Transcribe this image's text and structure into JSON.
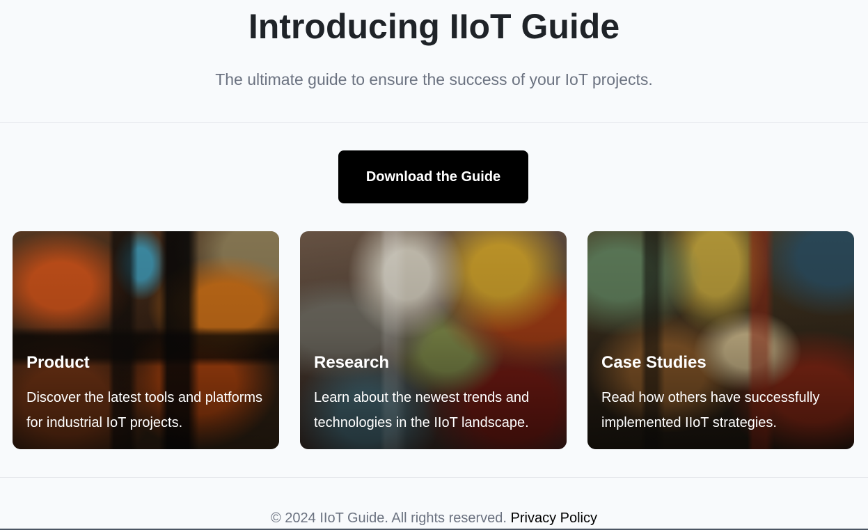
{
  "hero": {
    "title": "Introducing IIoT Guide",
    "subtitle": "The ultimate guide to ensure the success of your IoT projects."
  },
  "cta": {
    "label": "Download the Guide"
  },
  "cards": [
    {
      "title": "Product",
      "description": "Discover the latest tools and platforms for industrial IoT projects."
    },
    {
      "title": "Research",
      "description": "Learn about the newest trends and technologies in the IIoT landscape."
    },
    {
      "title": "Case Studies",
      "description": "Read how others have successfully implemented IIoT strategies."
    }
  ],
  "footer": {
    "copyright": "© 2024 IIoT Guide. All rights reserved.",
    "privacy_link": "Privacy Policy"
  },
  "colors": {
    "background": "#f8fafc",
    "button_bg": "#000000",
    "button_text": "#ffffff",
    "muted_text": "#6b7280"
  }
}
